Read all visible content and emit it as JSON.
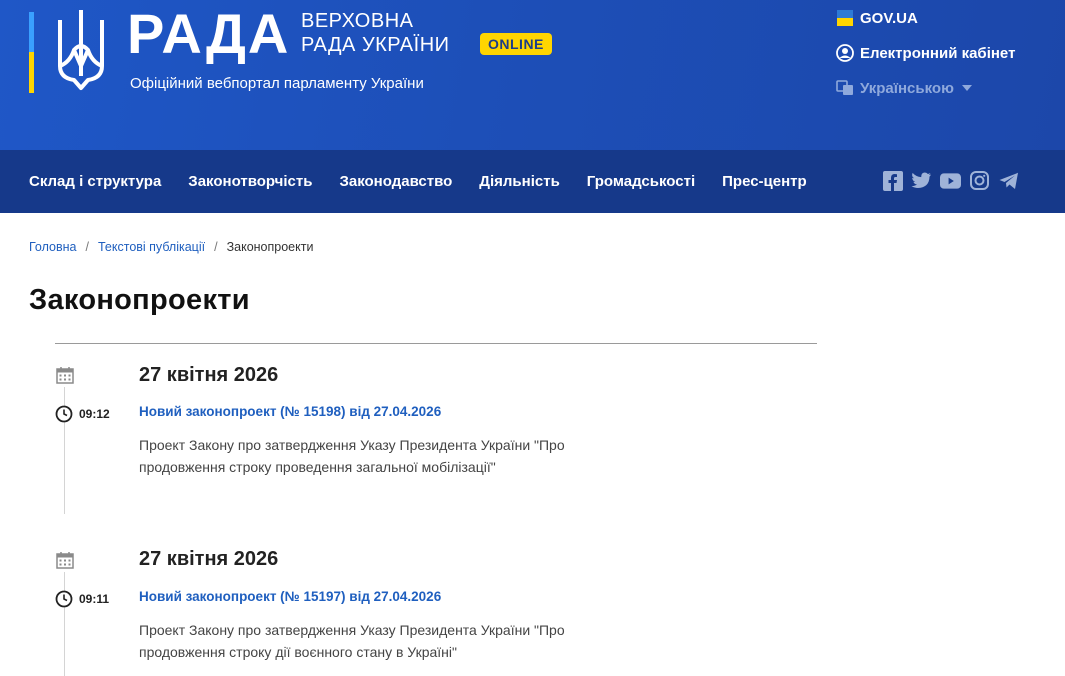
{
  "header": {
    "logo_word": "РАДА",
    "logo_sub_line1": "ВЕРХОВНА",
    "logo_sub_line2": "РАДА УКРАЇНИ",
    "online_badge": "ONLINE",
    "tagline": "Офіційний вебпортал парламенту України",
    "gov_link": "GOV.UA",
    "cabinet_link": "Електронний кабінет",
    "language": "Українською"
  },
  "nav": {
    "items": [
      "Склад і структура",
      "Законотворчість",
      "Законодавство",
      "Діяльність",
      "Громадськості",
      "Прес-центр"
    ]
  },
  "breadcrumb": {
    "items": [
      "Головна",
      "Текстові публікації"
    ],
    "current": "Законопроекти",
    "separator": "/"
  },
  "page_title": "Законопроекти",
  "entries": [
    {
      "date": "27 квітня 2026",
      "time": "09:12",
      "link": "Новий законопроект (№ 15198) від 27.04.2026",
      "description": "Проект Закону про затвердження Указу Президента України \"Про продовження строку проведення загальної мобілізації\""
    },
    {
      "date": "27 квітня 2026",
      "time": "09:11",
      "link": "Новий законопроект (№ 15197) від 27.04.2026",
      "description": "Проект Закону про затвердження Указу Президента України \"Про продовження строку дії воєнного стану в Україні\""
    }
  ],
  "colors": {
    "header_bg": "#1f57c7",
    "nav_bg": "#16398a",
    "link": "#1f5fbf",
    "accent_yellow": "#ffd500"
  }
}
